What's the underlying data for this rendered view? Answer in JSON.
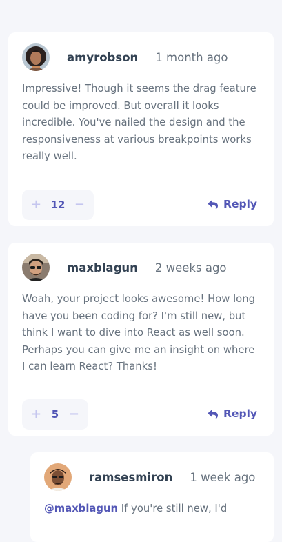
{
  "comments": [
    {
      "username": "amyrobson",
      "createdAt": "1 month ago",
      "content": "Impressive! Though it seems the drag feature could be improved. But overall it looks incredible. You've nailed the design and the responsiveness at various breakpoints works really well.",
      "score": "12",
      "reply_label": "Reply"
    },
    {
      "username": "maxblagun",
      "createdAt": "2 weeks ago",
      "content": "Woah, your project looks awesome! How long have you been coding for? I'm still new, but think I want to dive into React as well soon. Perhaps you can give me an insight on where I can learn React? Thanks!",
      "score": "5",
      "reply_label": "Reply"
    }
  ],
  "reply": {
    "username": "ramsesmiron",
    "createdAt": "1 week ago",
    "replyingTo": "@maxblagun",
    "content": "If you're still new, I'd"
  },
  "icons": {
    "plus": "+",
    "minus": "−",
    "reply": "reply-arrow-icon"
  },
  "colors": {
    "background": "#f5f6fa",
    "card": "#ffffff",
    "accent": "#5357b6",
    "accent_light": "#c5c6ef",
    "username": "#334253",
    "text": "#67727e"
  }
}
